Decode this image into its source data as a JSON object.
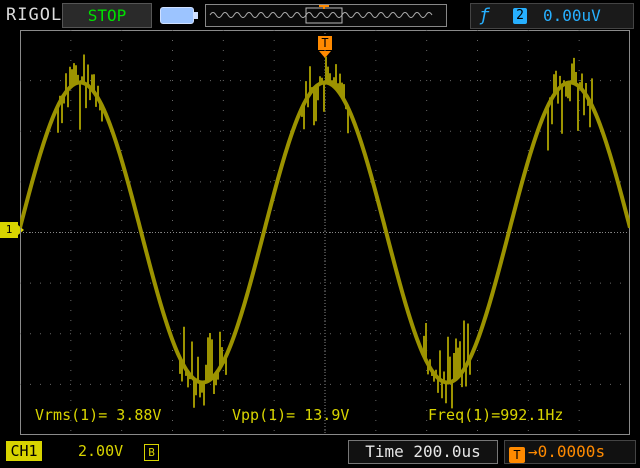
{
  "brand": "RIGOL",
  "run_state": "STOP",
  "trigger": {
    "icon": "rising-edge-icon",
    "source": "2",
    "level": "0.00uV"
  },
  "channel": {
    "label": "CH1",
    "coupling_icon": "ac-coupling-icon",
    "scale": "2.00V",
    "bw_limit": "B",
    "ground_marker": "1"
  },
  "timebase": {
    "label": "Time",
    "value": "200.0us",
    "offset": "0.0000s",
    "offset_icon": "T"
  },
  "measurements": {
    "vrms": "Vrms(1)= 3.88V",
    "vpp": "Vpp(1)= 13.9V",
    "freq": "Freq(1)=992.1Hz"
  },
  "trigger_marker": "T",
  "colors": {
    "trace": "#9c9300",
    "ch1": "#d8d400",
    "trigger": "#ff8a00",
    "accent": "#27b0ff"
  }
}
